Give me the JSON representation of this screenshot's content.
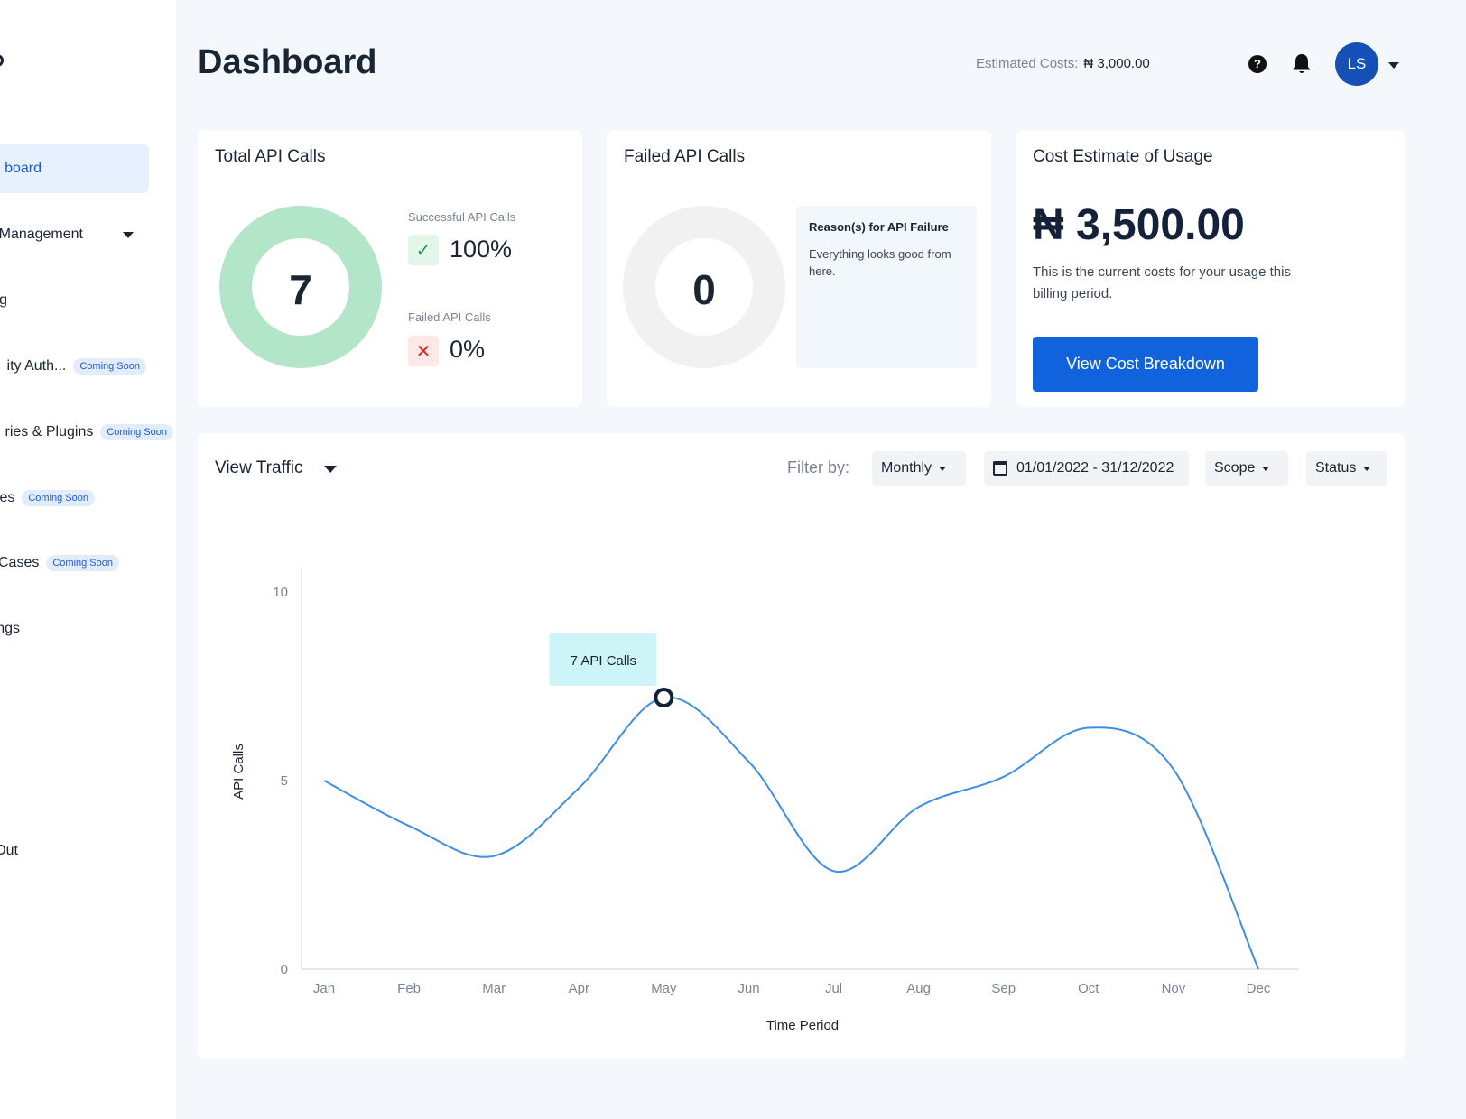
{
  "sidebar": {
    "items": [
      {
        "label": "board",
        "active": true
      },
      {
        "label": "Management",
        "has_chevron": true
      },
      {
        "label": "g"
      },
      {
        "label": "ity Auth...",
        "badge": "Coming Soon"
      },
      {
        "label": "ries & Plugins",
        "badge": "Coming Soon"
      },
      {
        "label": "es",
        "badge": "Coming Soon"
      },
      {
        "label": "Cases",
        "badge": "Coming Soon"
      },
      {
        "label": "ngs"
      },
      {
        "label": "Out"
      }
    ]
  },
  "header": {
    "title": "Dashboard",
    "estimated_costs_label": "Estimated Costs:",
    "estimated_costs_value": "₦ 3,000.00",
    "help_glyph": "?",
    "avatar_initials": "LS"
  },
  "total_calls": {
    "title": "Total API Calls",
    "total": "7",
    "successful_label": "Successful API Calls",
    "successful_value": "100%",
    "successful_icon": "✓",
    "failed_label": "Failed API Calls",
    "failed_value": "0%",
    "failed_icon": "✕",
    "success_fraction": 1.0,
    "ring_color": "#b3e5c8"
  },
  "failed_calls": {
    "title": "Failed API Calls",
    "total": "0",
    "reason_title": "Reason(s) for API Failure",
    "reason_text": "Everything looks good from here.",
    "ring_color": "#f1f1f1"
  },
  "cost": {
    "title": "Cost Estimate of Usage",
    "amount": "₦ 3,500.00",
    "description": "This is the current costs for your usage this billing period.",
    "button_label": "View Cost Breakdown"
  },
  "traffic": {
    "title": "View Traffic",
    "filter_label": "Filter by:",
    "period": "Monthly",
    "date_range": "01/01/2022 - 31/12/2022",
    "scope": "Scope",
    "status": "Status"
  },
  "chart_data": {
    "type": "line",
    "x": [
      "Jan",
      "Feb",
      "Mar",
      "Apr",
      "May",
      "Jun",
      "Jul",
      "Aug",
      "Sep",
      "Oct",
      "Nov",
      "Dec"
    ],
    "series": [
      {
        "values": [
          5,
          3.8,
          3,
          4.8,
          7.2,
          5.5,
          2.6,
          4.3,
          5.1,
          6.4,
          5.3,
          0
        ]
      }
    ],
    "xlabel": "Time Period",
    "ylabel": "API Calls",
    "ylim": [
      0,
      10
    ],
    "yticks": [
      0,
      5,
      10
    ],
    "tooltip": {
      "label": "7 API Calls",
      "index": 4
    },
    "line_color": "#3d8ee6",
    "grid": false
  }
}
